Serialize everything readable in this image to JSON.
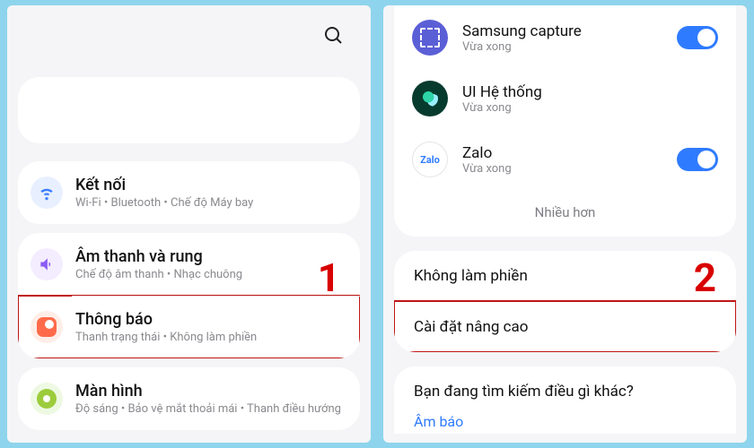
{
  "step_labels": {
    "left": "1",
    "right": "2"
  },
  "left": {
    "search_label": "search",
    "rows": [
      {
        "icon": "wifi-icon",
        "title": "Kết nối",
        "sub": "Wi-Fi • Bluetooth • Chế độ Máy bay"
      },
      {
        "icon": "sound-icon",
        "title": "Âm thanh và rung",
        "sub": "Chế độ âm thanh • Nhạc chuông"
      },
      {
        "icon": "notifications-icon",
        "title": "Thông báo",
        "sub": "Thanh trạng thái • Không làm phiền"
      },
      {
        "icon": "display-icon",
        "title": "Màn hình",
        "sub": "Độ sáng • Bảo vệ mắt thoải mái • Thanh điều hướng"
      }
    ]
  },
  "right": {
    "recent_apps": [
      {
        "icon": "capture-icon",
        "title": "Samsung capture",
        "sub": "Vừa xong",
        "toggle": true
      },
      {
        "icon": "system-ui-icon",
        "title": "UI Hệ thống",
        "sub": "Vừa xong",
        "toggle": false
      },
      {
        "icon": "zalo-icon",
        "title": "Zalo",
        "sub": "Vừa xong",
        "toggle": true
      }
    ],
    "more": "Nhiều hơn",
    "flat_items": [
      "Không làm phiền",
      "Cài đặt nâng cao"
    ],
    "suggest": {
      "q": "Bạn đang tìm kiếm điều gì khác?",
      "link": "Âm báo"
    },
    "zalo_badge": "Zalo"
  }
}
